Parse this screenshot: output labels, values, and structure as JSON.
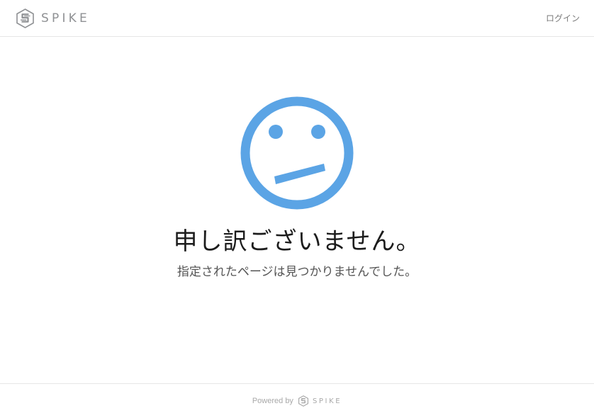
{
  "header": {
    "brand_name": "SPIKE",
    "brand_icon": "spike-logo-icon",
    "login_label": "ログイン"
  },
  "error": {
    "illustration_icon": "confused-face-icon",
    "title": "申し訳ございません。",
    "message": "指定されたページは見つかりませんでした。"
  },
  "footer": {
    "powered_by_label": "Powered by",
    "brand_name": "SPIKE",
    "brand_icon": "spike-logo-icon"
  },
  "colors": {
    "accent": "#5ba4e5",
    "brand_gray": "#8f9194",
    "divider": "#e6e6e6"
  }
}
